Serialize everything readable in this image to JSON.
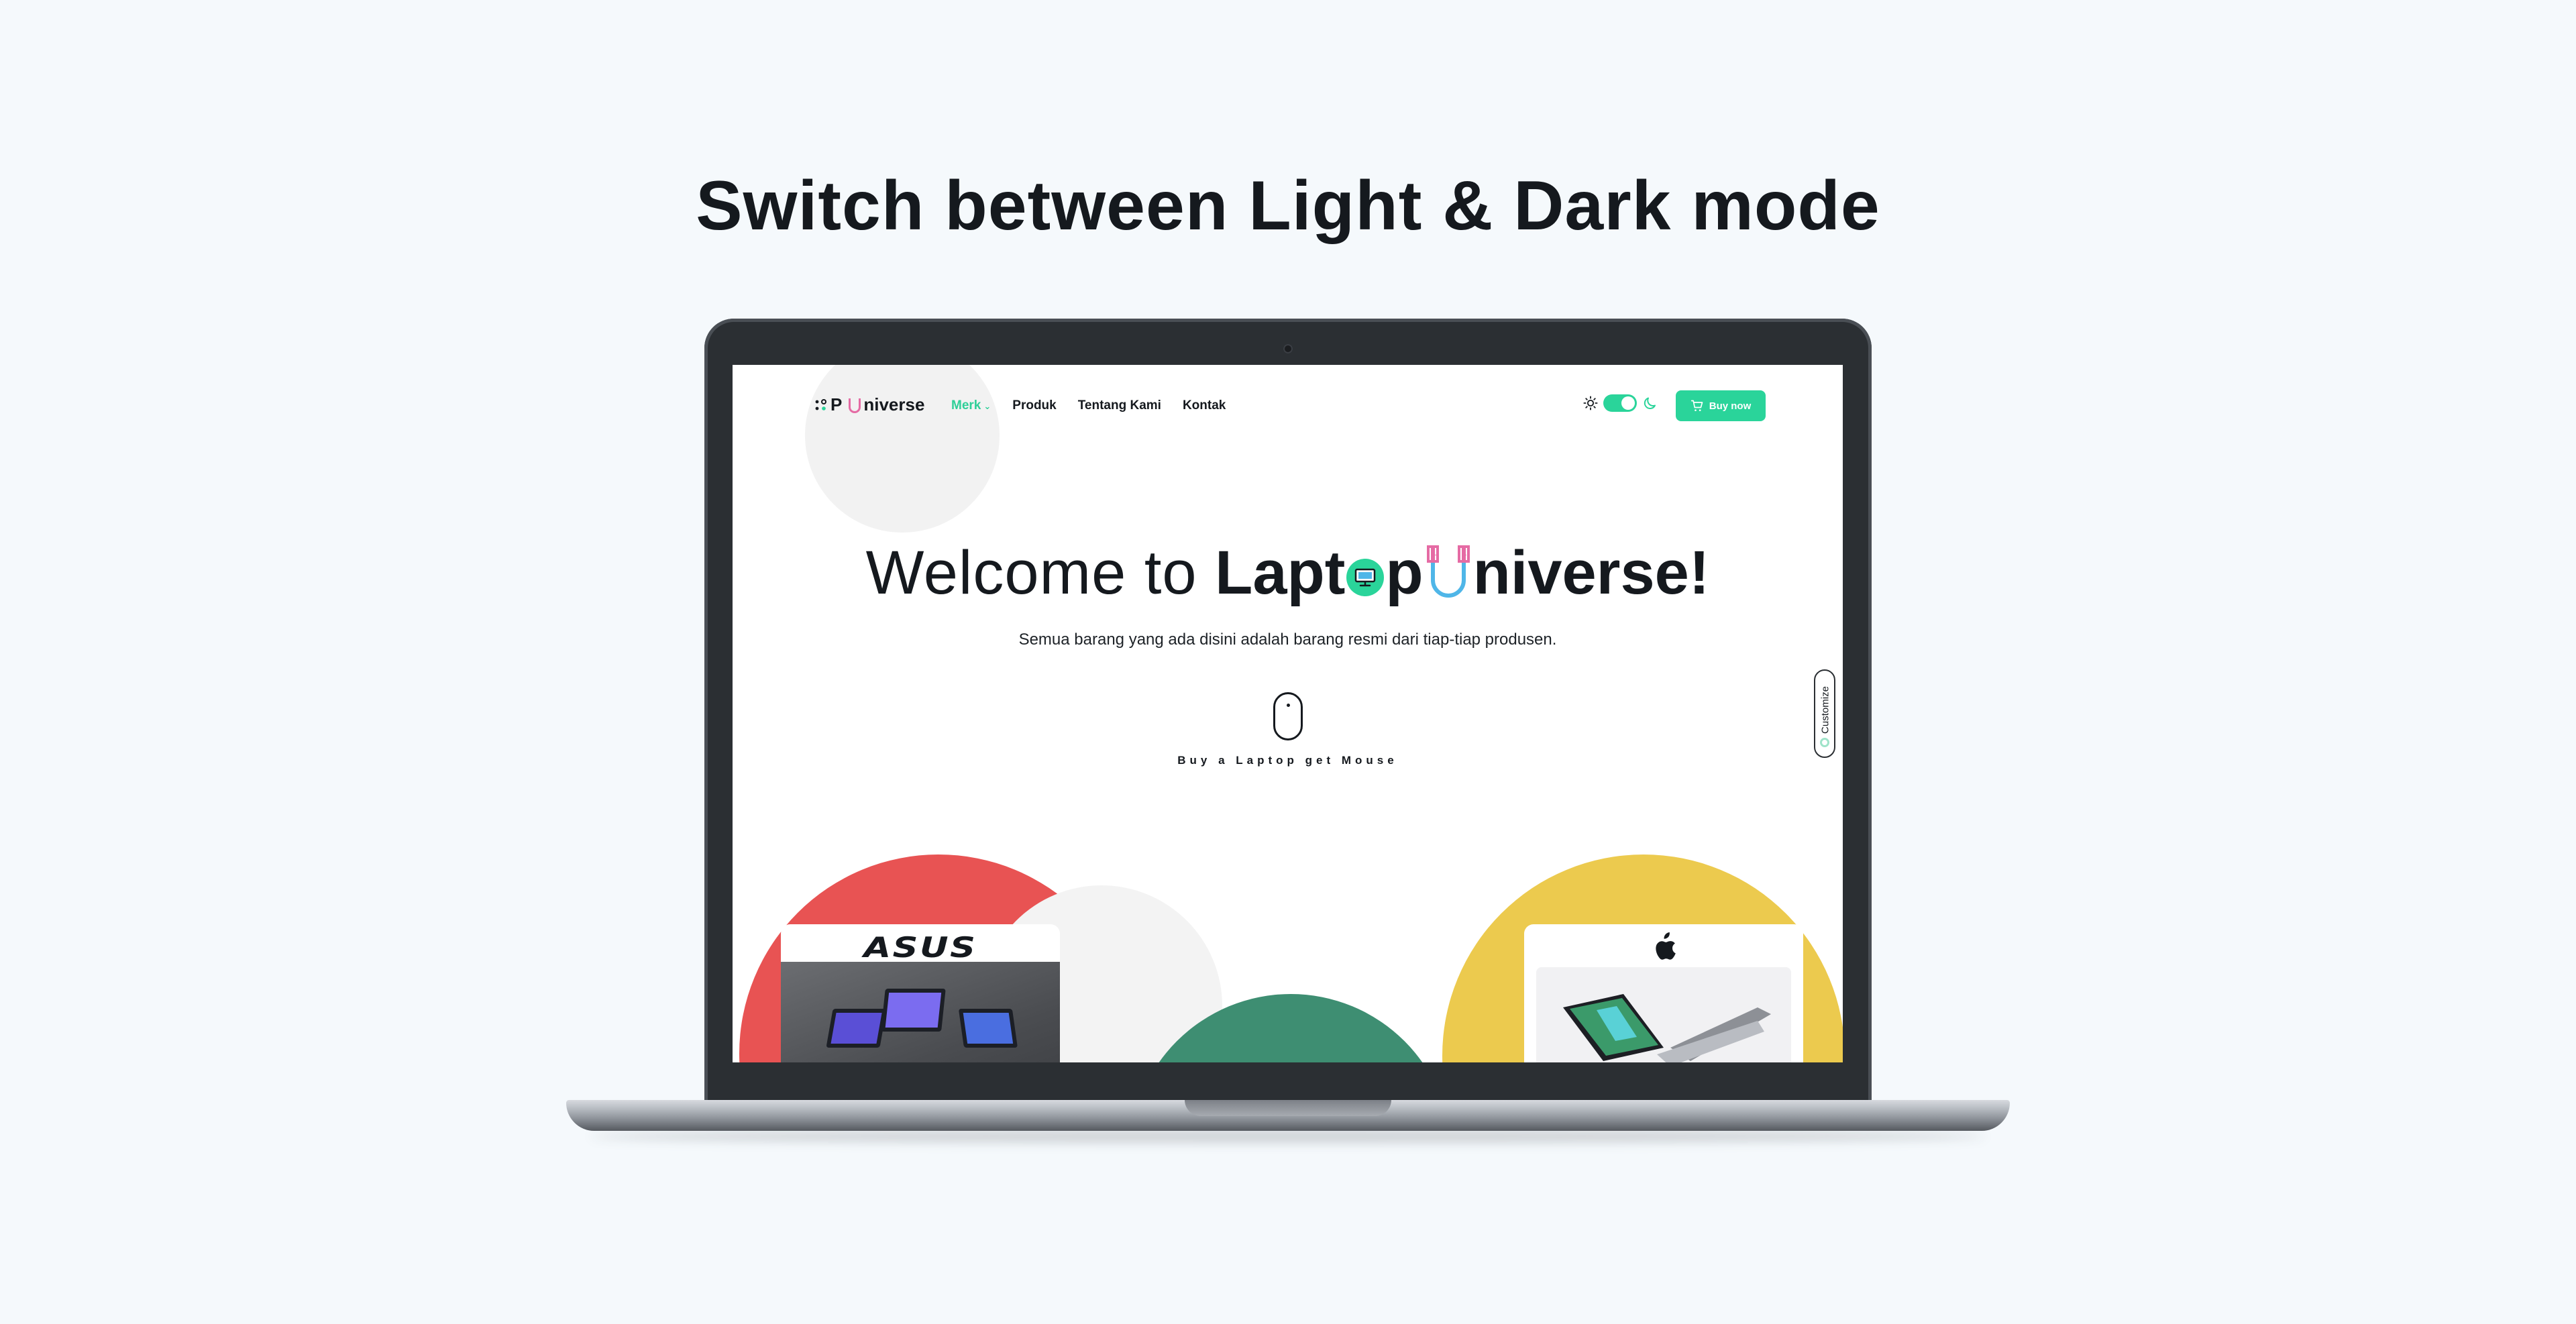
{
  "banner": {
    "title": "Switch between Light & Dark mode"
  },
  "nav": {
    "logo_text_p": "P",
    "logo_text_rest": "niverse",
    "links": [
      {
        "label": "Merk",
        "active": true,
        "has_dropdown": true
      },
      {
        "label": "Produk",
        "active": false
      },
      {
        "label": "Tentang Kami",
        "active": false
      },
      {
        "label": "Kontak",
        "active": false
      }
    ],
    "theme_toggle_state": "on",
    "buy_label": "Buy now"
  },
  "hero": {
    "title_prefix": "Welcome to ",
    "brand_part1": "Lapt",
    "brand_part2": "p",
    "brand_part3": "niverse!",
    "subtitle": "Semua barang yang ada disini adalah barang resmi dari tiap-tiap produsen.",
    "mouse_caption": "Buy a Laptop get Mouse"
  },
  "sidebar_tab": {
    "label": "Customize"
  },
  "showcase": {
    "cards": [
      {
        "brand": "ASUS",
        "bg_color": "#e85353"
      },
      {
        "brand": "Apple",
        "bg_color": "#ecca4e"
      }
    ],
    "middle_circle_color": "#3e8e72"
  },
  "colors": {
    "accent": "#2ad49a",
    "magnet_pink": "#e56ba4",
    "magnet_blue": "#4fb6e8",
    "page_bg": "#f5f9fc"
  },
  "icons": [
    "sun-icon",
    "moon-icon",
    "cart-icon",
    "chevron-down-icon",
    "mouse-icon",
    "apple-logo-icon",
    "monitor-icon",
    "magnet-u-icon"
  ]
}
